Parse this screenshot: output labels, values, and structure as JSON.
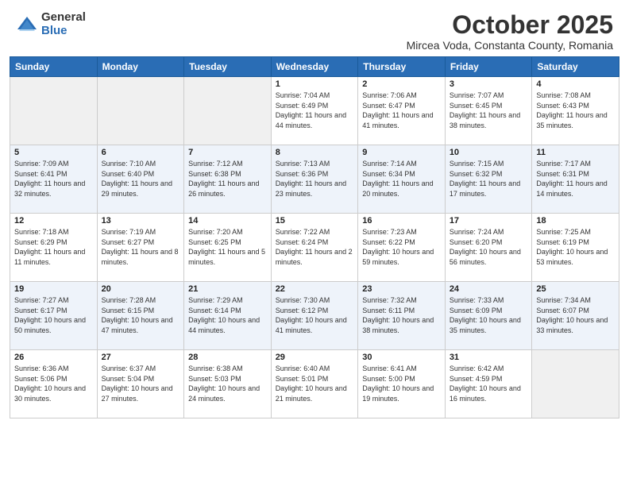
{
  "header": {
    "logo_general": "General",
    "logo_blue": "Blue",
    "month_title": "October 2025",
    "location": "Mircea Voda, Constanta County, Romania"
  },
  "days_of_week": [
    "Sunday",
    "Monday",
    "Tuesday",
    "Wednesday",
    "Thursday",
    "Friday",
    "Saturday"
  ],
  "weeks": [
    {
      "row_class": "week-row-0",
      "days": [
        {
          "num": "",
          "info": "",
          "empty": true
        },
        {
          "num": "",
          "info": "",
          "empty": true
        },
        {
          "num": "",
          "info": "",
          "empty": true
        },
        {
          "num": "1",
          "info": "Sunrise: 7:04 AM\nSunset: 6:49 PM\nDaylight: 11 hours and 44 minutes.",
          "empty": false
        },
        {
          "num": "2",
          "info": "Sunrise: 7:06 AM\nSunset: 6:47 PM\nDaylight: 11 hours and 41 minutes.",
          "empty": false
        },
        {
          "num": "3",
          "info": "Sunrise: 7:07 AM\nSunset: 6:45 PM\nDaylight: 11 hours and 38 minutes.",
          "empty": false
        },
        {
          "num": "4",
          "info": "Sunrise: 7:08 AM\nSunset: 6:43 PM\nDaylight: 11 hours and 35 minutes.",
          "empty": false
        }
      ]
    },
    {
      "row_class": "week-row-1",
      "days": [
        {
          "num": "5",
          "info": "Sunrise: 7:09 AM\nSunset: 6:41 PM\nDaylight: 11 hours and 32 minutes.",
          "empty": false
        },
        {
          "num": "6",
          "info": "Sunrise: 7:10 AM\nSunset: 6:40 PM\nDaylight: 11 hours and 29 minutes.",
          "empty": false
        },
        {
          "num": "7",
          "info": "Sunrise: 7:12 AM\nSunset: 6:38 PM\nDaylight: 11 hours and 26 minutes.",
          "empty": false
        },
        {
          "num": "8",
          "info": "Sunrise: 7:13 AM\nSunset: 6:36 PM\nDaylight: 11 hours and 23 minutes.",
          "empty": false
        },
        {
          "num": "9",
          "info": "Sunrise: 7:14 AM\nSunset: 6:34 PM\nDaylight: 11 hours and 20 minutes.",
          "empty": false
        },
        {
          "num": "10",
          "info": "Sunrise: 7:15 AM\nSunset: 6:32 PM\nDaylight: 11 hours and 17 minutes.",
          "empty": false
        },
        {
          "num": "11",
          "info": "Sunrise: 7:17 AM\nSunset: 6:31 PM\nDaylight: 11 hours and 14 minutes.",
          "empty": false
        }
      ]
    },
    {
      "row_class": "week-row-2",
      "days": [
        {
          "num": "12",
          "info": "Sunrise: 7:18 AM\nSunset: 6:29 PM\nDaylight: 11 hours and 11 minutes.",
          "empty": false
        },
        {
          "num": "13",
          "info": "Sunrise: 7:19 AM\nSunset: 6:27 PM\nDaylight: 11 hours and 8 minutes.",
          "empty": false
        },
        {
          "num": "14",
          "info": "Sunrise: 7:20 AM\nSunset: 6:25 PM\nDaylight: 11 hours and 5 minutes.",
          "empty": false
        },
        {
          "num": "15",
          "info": "Sunrise: 7:22 AM\nSunset: 6:24 PM\nDaylight: 11 hours and 2 minutes.",
          "empty": false
        },
        {
          "num": "16",
          "info": "Sunrise: 7:23 AM\nSunset: 6:22 PM\nDaylight: 10 hours and 59 minutes.",
          "empty": false
        },
        {
          "num": "17",
          "info": "Sunrise: 7:24 AM\nSunset: 6:20 PM\nDaylight: 10 hours and 56 minutes.",
          "empty": false
        },
        {
          "num": "18",
          "info": "Sunrise: 7:25 AM\nSunset: 6:19 PM\nDaylight: 10 hours and 53 minutes.",
          "empty": false
        }
      ]
    },
    {
      "row_class": "week-row-3",
      "days": [
        {
          "num": "19",
          "info": "Sunrise: 7:27 AM\nSunset: 6:17 PM\nDaylight: 10 hours and 50 minutes.",
          "empty": false
        },
        {
          "num": "20",
          "info": "Sunrise: 7:28 AM\nSunset: 6:15 PM\nDaylight: 10 hours and 47 minutes.",
          "empty": false
        },
        {
          "num": "21",
          "info": "Sunrise: 7:29 AM\nSunset: 6:14 PM\nDaylight: 10 hours and 44 minutes.",
          "empty": false
        },
        {
          "num": "22",
          "info": "Sunrise: 7:30 AM\nSunset: 6:12 PM\nDaylight: 10 hours and 41 minutes.",
          "empty": false
        },
        {
          "num": "23",
          "info": "Sunrise: 7:32 AM\nSunset: 6:11 PM\nDaylight: 10 hours and 38 minutes.",
          "empty": false
        },
        {
          "num": "24",
          "info": "Sunrise: 7:33 AM\nSunset: 6:09 PM\nDaylight: 10 hours and 35 minutes.",
          "empty": false
        },
        {
          "num": "25",
          "info": "Sunrise: 7:34 AM\nSunset: 6:07 PM\nDaylight: 10 hours and 33 minutes.",
          "empty": false
        }
      ]
    },
    {
      "row_class": "week-row-4",
      "days": [
        {
          "num": "26",
          "info": "Sunrise: 6:36 AM\nSunset: 5:06 PM\nDaylight: 10 hours and 30 minutes.",
          "empty": false
        },
        {
          "num": "27",
          "info": "Sunrise: 6:37 AM\nSunset: 5:04 PM\nDaylight: 10 hours and 27 minutes.",
          "empty": false
        },
        {
          "num": "28",
          "info": "Sunrise: 6:38 AM\nSunset: 5:03 PM\nDaylight: 10 hours and 24 minutes.",
          "empty": false
        },
        {
          "num": "29",
          "info": "Sunrise: 6:40 AM\nSunset: 5:01 PM\nDaylight: 10 hours and 21 minutes.",
          "empty": false
        },
        {
          "num": "30",
          "info": "Sunrise: 6:41 AM\nSunset: 5:00 PM\nDaylight: 10 hours and 19 minutes.",
          "empty": false
        },
        {
          "num": "31",
          "info": "Sunrise: 6:42 AM\nSunset: 4:59 PM\nDaylight: 10 hours and 16 minutes.",
          "empty": false
        },
        {
          "num": "",
          "info": "",
          "empty": true
        }
      ]
    }
  ]
}
